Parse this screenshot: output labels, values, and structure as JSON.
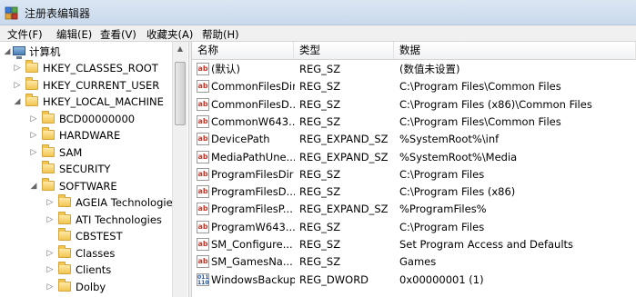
{
  "window": {
    "title": "注册表编辑器"
  },
  "menu": [
    "文件(F)",
    "编辑(E)",
    "查看(V)",
    "收藏夹(A)",
    "帮助(H)"
  ],
  "tree": {
    "root": "计算机",
    "hives": [
      "HKEY_CLASSES_ROOT",
      "HKEY_CURRENT_USER",
      "HKEY_LOCAL_MACHINE"
    ],
    "hklm_keys": [
      "BCD00000000",
      "HARDWARE",
      "SAM",
      "SECURITY",
      "SOFTWARE"
    ],
    "software_keys": [
      "AGEIA Technologies",
      "ATI Technologies",
      "CBSTEST",
      "Classes",
      "Clients",
      "Dolby"
    ]
  },
  "list": {
    "columns": [
      "名称",
      "类型",
      "数据"
    ],
    "rows": [
      {
        "name": "(默认)",
        "type": "REG_SZ",
        "data": "(数值未设置)",
        "icon": "string-value-icon"
      },
      {
        "name": "CommonFilesDir",
        "type": "REG_SZ",
        "data": "C:\\Program Files\\Common Files",
        "icon": "string-value-icon"
      },
      {
        "name": "CommonFilesD...",
        "type": "REG_SZ",
        "data": "C:\\Program Files (x86)\\Common Files",
        "icon": "string-value-icon"
      },
      {
        "name": "CommonW643...",
        "type": "REG_SZ",
        "data": "C:\\Program Files\\Common Files",
        "icon": "string-value-icon"
      },
      {
        "name": "DevicePath",
        "type": "REG_EXPAND_SZ",
        "data": "%SystemRoot%\\inf",
        "icon": "string-value-icon"
      },
      {
        "name": "MediaPathUne...",
        "type": "REG_EXPAND_SZ",
        "data": "%SystemRoot%\\Media",
        "icon": "string-value-icon"
      },
      {
        "name": "ProgramFilesDir",
        "type": "REG_SZ",
        "data": "C:\\Program Files",
        "icon": "string-value-icon"
      },
      {
        "name": "ProgramFilesD...",
        "type": "REG_SZ",
        "data": "C:\\Program Files (x86)",
        "icon": "string-value-icon"
      },
      {
        "name": "ProgramFilesP...",
        "type": "REG_EXPAND_SZ",
        "data": "%ProgramFiles%",
        "icon": "string-value-icon"
      },
      {
        "name": "ProgramW643...",
        "type": "REG_SZ",
        "data": "C:\\Program Files",
        "icon": "string-value-icon"
      },
      {
        "name": "SM_Configure...",
        "type": "REG_SZ",
        "data": "Set Program Access and Defaults",
        "icon": "string-value-icon"
      },
      {
        "name": "SM_GamesNa...",
        "type": "REG_SZ",
        "data": "Games",
        "icon": "string-value-icon"
      },
      {
        "name": "WindowsBackup",
        "type": "REG_DWORD",
        "data": "0x00000001 (1)",
        "icon": "binary-value-icon"
      }
    ]
  },
  "icons": {
    "string": "ab",
    "binary": "011\n110"
  }
}
